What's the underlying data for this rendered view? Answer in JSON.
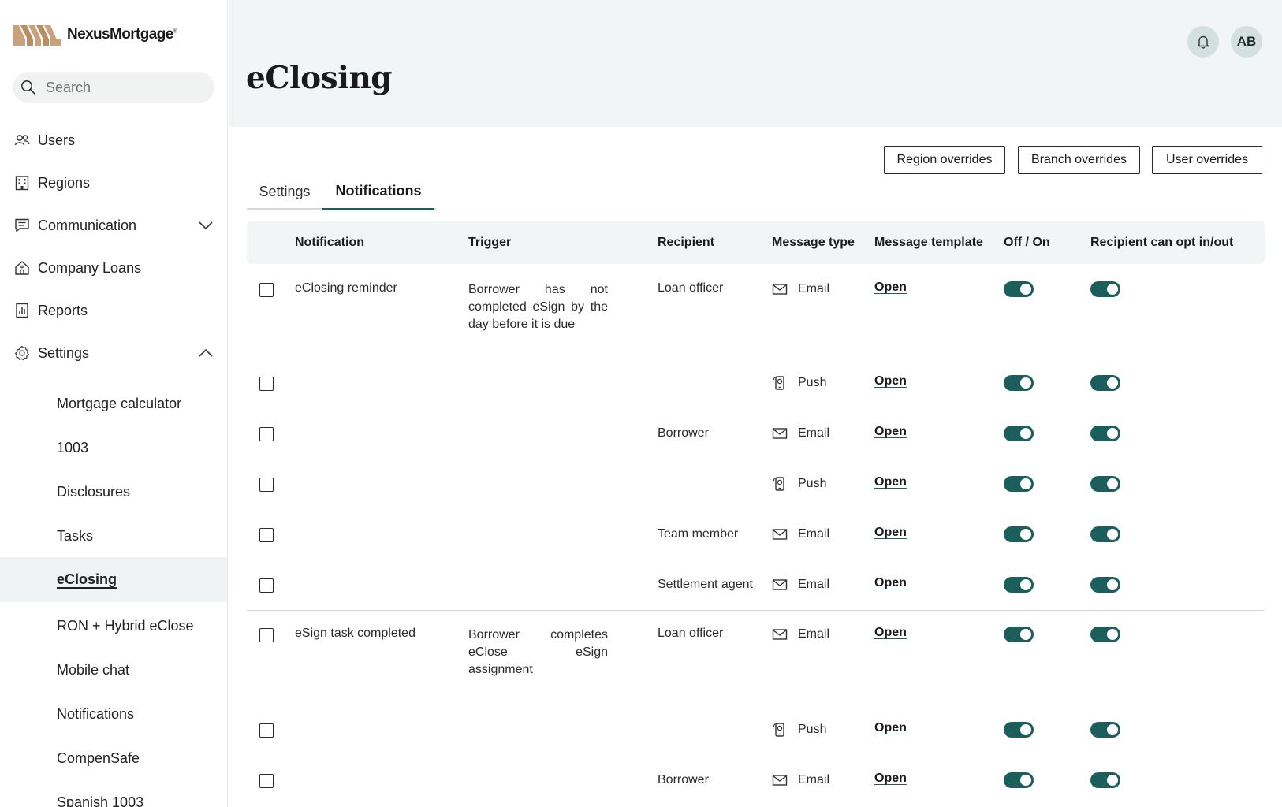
{
  "brand": {
    "name": "NexusMortgage",
    "reg": "®"
  },
  "search": {
    "placeholder": "Search"
  },
  "nav": {
    "items": [
      {
        "label": "Users",
        "icon": "users-icon"
      },
      {
        "label": "Regions",
        "icon": "building-icon"
      },
      {
        "label": "Communication",
        "icon": "chat-icon"
      },
      {
        "label": "Company Loans",
        "icon": "home-icon"
      },
      {
        "label": "Reports",
        "icon": "report-icon"
      },
      {
        "label": "Settings",
        "icon": "gear-icon"
      }
    ],
    "settings_sub": [
      "Mortgage calculator",
      "1003",
      "Disclosures",
      "Tasks",
      "eClosing",
      "RON + Hybrid eClose",
      "Mobile chat",
      "Notifications",
      "CompenSafe",
      "Spanish 1003"
    ],
    "active_sub": "eClosing"
  },
  "header": {
    "title": "eClosing",
    "avatar_initials": "AB"
  },
  "overrides": {
    "region": "Region overrides",
    "branch": "Branch overrides",
    "user": "User overrides"
  },
  "tabs": [
    {
      "label": "Settings",
      "active": false
    },
    {
      "label": "Notifications",
      "active": true
    }
  ],
  "table": {
    "headers": {
      "notification": "Notification",
      "trigger": "Trigger",
      "recipient": "Recipient",
      "message_type": "Message type",
      "message_template": "Message template",
      "off_on": "Off / On",
      "opt": "Recipient can opt in/out"
    },
    "rows": [
      {
        "notification": "eClosing reminder",
        "trigger": "Borrower has not completed eSign by the day before it is due",
        "recipient": "Loan officer",
        "type": "Email",
        "template": "Open",
        "on": true,
        "opt": true
      },
      {
        "notification": "",
        "trigger": "",
        "recipient": "",
        "type": "Push",
        "template": "Open",
        "on": true,
        "opt": true
      },
      {
        "notification": "",
        "trigger": "",
        "recipient": "Borrower",
        "type": "Email",
        "template": "Open",
        "on": true,
        "opt": true
      },
      {
        "notification": "",
        "trigger": "",
        "recipient": "",
        "type": "Push",
        "template": "Open",
        "on": true,
        "opt": true
      },
      {
        "notification": "",
        "trigger": "",
        "recipient": "Team member",
        "type": "Email",
        "template": "Open",
        "on": true,
        "opt": true
      },
      {
        "notification": "",
        "trigger": "",
        "recipient": "Settlement agent",
        "type": "Email",
        "template": "Open",
        "on": true,
        "opt": true
      },
      {
        "notification": "eSign task completed",
        "trigger": "Borrower completes eClose eSign assignment",
        "recipient": "Loan officer",
        "type": "Email",
        "template": "Open",
        "on": true,
        "opt": true
      },
      {
        "notification": "",
        "trigger": "",
        "recipient": "",
        "type": "Push",
        "template": "Open",
        "on": true,
        "opt": true
      },
      {
        "notification": "",
        "trigger": "",
        "recipient": "Borrower",
        "type": "Email",
        "template": "Open",
        "on": true,
        "opt": true
      }
    ]
  },
  "colors": {
    "accent": "#1b5e5c",
    "header_bg": "#f1f5f5",
    "active_nav_bg": "#eff3f3",
    "logo": "#c9a27c"
  }
}
